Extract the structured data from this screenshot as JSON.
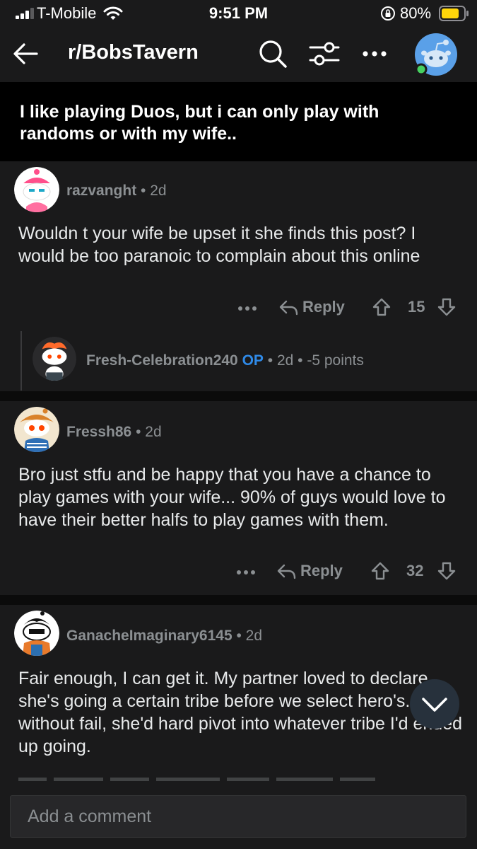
{
  "status_bar": {
    "carrier": "T-Mobile",
    "time": "9:51 PM",
    "battery_percent": "80%",
    "battery_level": 0.8,
    "icons": [
      "signal-icon",
      "wifi-icon",
      "orientation-lock-icon",
      "battery-icon"
    ]
  },
  "header": {
    "title": "r/BobsTavern",
    "icons": [
      "back-icon",
      "search-icon",
      "filter-icon",
      "more-icon",
      "avatar"
    ]
  },
  "post": {
    "title": "I like playing Duos, but i can only play with randoms or with my wife.."
  },
  "comments": [
    {
      "username": "razvanght",
      "age": "• 2d",
      "body": "Wouldn t your wife be upset it she finds this post? I would be too paranoic to complain about this online",
      "reply_label": "Reply",
      "votes": "15"
    },
    {
      "username": "Fresh-Celebration240",
      "op_badge": "OP",
      "age": "• 2d • -5 points",
      "collapsed": true
    },
    {
      "username": "Fressh86",
      "age": "• 2d",
      "body": "Bro just stfu and be happy that you have a chance to play games with your wife... 90% of guys would love to have their better halfs to play games with them.",
      "reply_label": "Reply",
      "votes": "32"
    },
    {
      "username": "GanacheImaginary6145",
      "age": "• 2d",
      "body": "Fair enough, I can get it. My partner loved to declare she's going a certain tribe before we select hero's. Then, without fail, she'd hard pivot into whatever tribe I'd ended up going."
    }
  ],
  "comment_bar": {
    "placeholder": "Add a comment"
  },
  "colors": {
    "background": "#1a1a1b",
    "post_title_bg": "#000000",
    "meta_text": "#8b8f92",
    "op_blue": "#2f8ae8",
    "online_green": "#46d160",
    "battery_yellow": "#ffd60a"
  }
}
